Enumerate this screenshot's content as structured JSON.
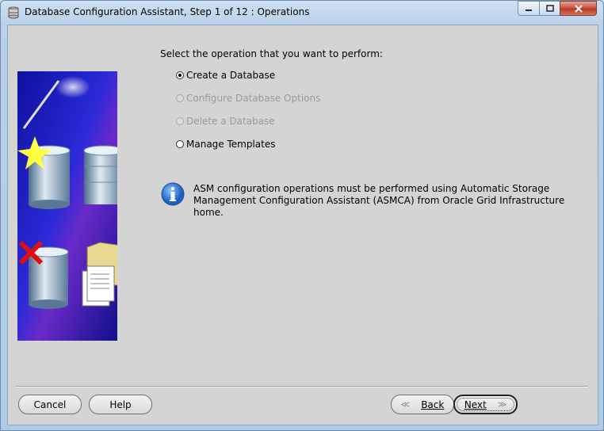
{
  "window": {
    "title": "Database Configuration Assistant, Step 1 of 12 : Operations",
    "controls": {
      "minimize": "–",
      "maximize": "□",
      "close": "✕"
    }
  },
  "main": {
    "prompt": "Select the operation that you want to perform:",
    "operations": [
      {
        "label": "Create a Database",
        "selected": true,
        "enabled": true
      },
      {
        "label": "Configure Database Options",
        "selected": false,
        "enabled": false
      },
      {
        "label": "Delete a Database",
        "selected": false,
        "enabled": false
      },
      {
        "label": "Manage Templates",
        "selected": false,
        "enabled": true
      }
    ],
    "info": {
      "icon": "info-icon",
      "line1": "ASM configuration operations must be performed using Automatic Storage",
      "line2": "Management Configuration Assistant (ASMCA) from Oracle Grid Infrastructure home."
    }
  },
  "footer": {
    "cancel_label": "Cancel",
    "help_label": "Help",
    "back_label": "Back",
    "next_label": "Next",
    "back_chevron": "≪",
    "next_chevron": "≫"
  },
  "colors": {
    "dialog_bg": "#d4d4d4",
    "frame": "#b9d1ea",
    "close_button": "#c7503a",
    "info_blue": "#2a6fd0",
    "banner_blue": "#1a1ab8"
  }
}
